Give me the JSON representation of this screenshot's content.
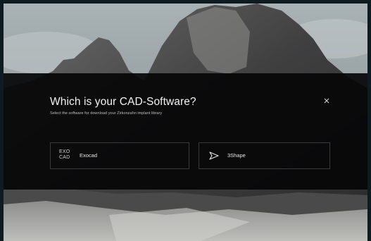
{
  "dialog": {
    "title": "Which is your CAD-Software?",
    "subtitle": "Select the software for download your Zirkonzahn implant library",
    "close_icon": "close-icon"
  },
  "options": [
    {
      "id": "exocad",
      "logo_icon": "exocad-logo-icon",
      "logo_text_top": "EXO",
      "logo_text_bottom": "CAD",
      "label": "Exocad"
    },
    {
      "id": "3shape",
      "logo_icon": "3shape-logo-icon",
      "label": "3Shape"
    }
  ],
  "colors": {
    "modal_background": "#060607",
    "option_border": "#3a3a3a",
    "title_text": "#f2f2f2"
  }
}
